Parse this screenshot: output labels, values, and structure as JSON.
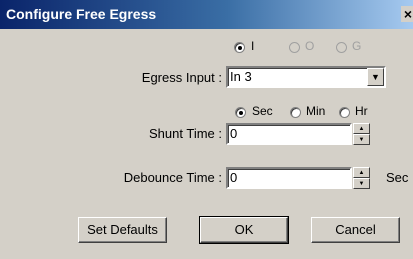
{
  "window": {
    "title": "Configure Free Egress",
    "close_glyph": "×"
  },
  "egress_type": {
    "options": [
      {
        "label": "I",
        "checked": true,
        "disabled": false
      },
      {
        "label": "O",
        "checked": false,
        "disabled": true
      },
      {
        "label": "G",
        "checked": false,
        "disabled": true
      }
    ]
  },
  "egress_input": {
    "label": "Egress Input :",
    "value": "In 3"
  },
  "time_units": {
    "options": [
      {
        "label": "Sec",
        "checked": true
      },
      {
        "label": "Min",
        "checked": false
      },
      {
        "label": "Hr",
        "checked": false
      }
    ]
  },
  "shunt_time": {
    "label": "Shunt Time :",
    "value": "0"
  },
  "debounce_time": {
    "label": "Debounce Time :",
    "value": "0",
    "unit": "Sec"
  },
  "buttons": {
    "set_defaults": "Set Defaults",
    "ok": "OK",
    "cancel": "Cancel"
  }
}
